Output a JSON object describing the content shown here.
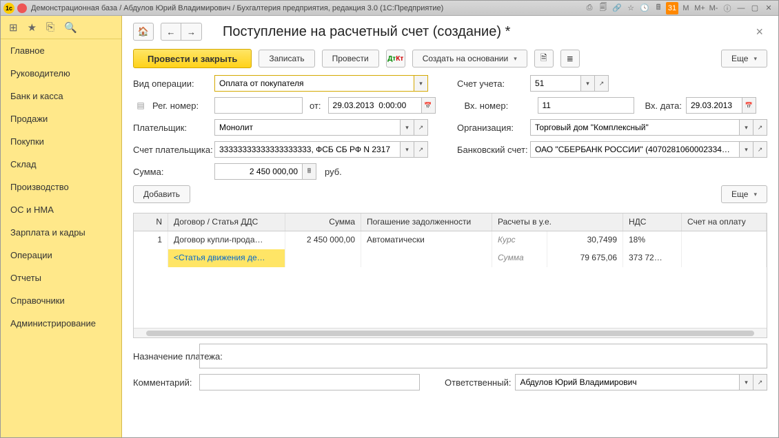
{
  "title": "Демонстрационная база / Абдулов Юрий Владимирович / Бухгалтерия предприятия, редакция 3.0  (1С:Предприятие)",
  "sidebar": {
    "items": [
      "Главное",
      "Руководителю",
      "Банк и касса",
      "Продажи",
      "Покупки",
      "Склад",
      "Производство",
      "ОС и НМА",
      "Зарплата и кадры",
      "Операции",
      "Отчеты",
      "Справочники",
      "Администрирование"
    ]
  },
  "page": {
    "title": "Поступление на расчетный счет (создание) *",
    "buttons": {
      "post_close": "Провести и закрыть",
      "save": "Записать",
      "post": "Провести",
      "create_based": "Создать на основании",
      "more": "Еще",
      "add": "Добавить",
      "more2": "Еще"
    },
    "labels": {
      "op_type": "Вид операции:",
      "reg_num": "Рег. номер:",
      "from": "от:",
      "payer": "Плательщик:",
      "payer_acc": "Счет плательщика:",
      "sum": "Сумма:",
      "rub": "руб.",
      "account": "Счет учета:",
      "in_num": "Вх. номер:",
      "in_date": "Вх. дата:",
      "org": "Организация:",
      "bank_acc": "Банковский счет:",
      "purpose": "Назначение платежа:",
      "comment": "Комментарий:",
      "responsible": "Ответственный:"
    },
    "values": {
      "op_type": "Оплата от покупателя",
      "reg_num": "",
      "date": "29.03.2013  0:00:00",
      "payer": "Монолит",
      "payer_acc": "33333333333333333333, ФСБ СБ РФ N 2317",
      "sum": "2 450 000,00",
      "account": "51",
      "in_num": "11",
      "in_date": "29.03.2013",
      "org": "Торговый дом \"Комплексный\"",
      "bank_acc": "ОАО \"СБЕРБАНК РОССИИ\" (4070281060002334…",
      "comment": "",
      "responsible": "Абдулов Юрий Владимирович"
    },
    "table": {
      "headers": {
        "n": "N",
        "dog": "Договор / Статья ДДС",
        "sum": "Сумма",
        "pog": "Погашение задолженности",
        "ras": "Расчеты в у.е.",
        "nds": "НДС",
        "sch": "Счет на оплату"
      },
      "rows": [
        {
          "n": "1",
          "dog": "Договор купли-прода…",
          "sum": "2 450 000,00",
          "pog": "Автоматически",
          "ras_lbl": "Курс",
          "ras_val": "30,7499",
          "nds": "18%",
          "sch": ""
        },
        {
          "n": "",
          "dog": "<Статья движения де…",
          "sum": "",
          "pog": "",
          "ras_lbl": "Сумма",
          "ras_val": "79 675,06",
          "nds": "373 72…",
          "sch": ""
        }
      ]
    }
  },
  "titlebar_icons": [
    "M",
    "M+",
    "M-"
  ]
}
